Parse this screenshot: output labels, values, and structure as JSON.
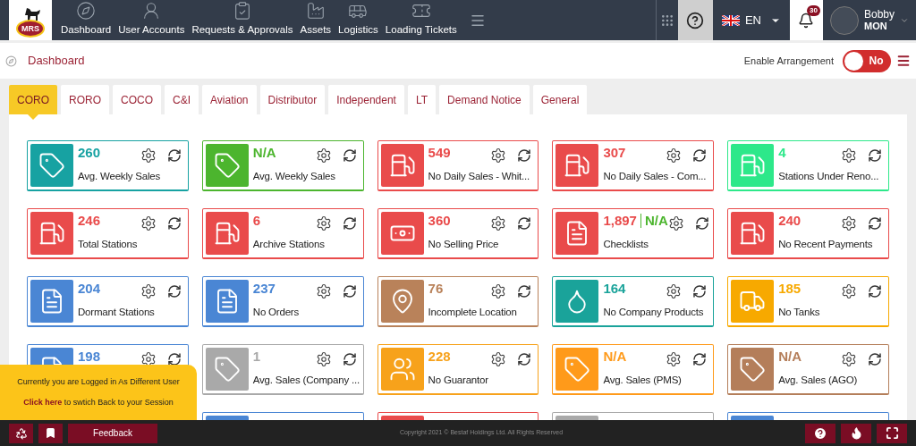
{
  "logo": {
    "text": "MRS"
  },
  "nav": [
    {
      "label": "Dashboard"
    },
    {
      "label": "User Accounts"
    },
    {
      "label": "Requests & Approvals"
    },
    {
      "label": "Assets"
    },
    {
      "label": "Logistics"
    },
    {
      "label": "Loading Tickets"
    }
  ],
  "language": "EN",
  "notifications": {
    "count": "30"
  },
  "user": {
    "name": "Bobby",
    "org": "MON"
  },
  "breadcrumb": "Dashboard",
  "arrangement": {
    "label": "Enable Arrangement",
    "on": false,
    "state_text": "No"
  },
  "tabs": [
    {
      "label": "CORO",
      "selected": true
    },
    {
      "label": "RORO",
      "selected": false
    },
    {
      "label": "COCO",
      "selected": false
    },
    {
      "label": "C&I",
      "selected": false
    },
    {
      "label": "Aviation",
      "selected": false
    },
    {
      "label": "Distributor",
      "selected": false
    },
    {
      "label": "Independent",
      "selected": false
    },
    {
      "label": "LT",
      "selected": false
    },
    {
      "label": "Demand Notice",
      "selected": false
    },
    {
      "label": "General",
      "selected": false
    }
  ],
  "cards": [
    {
      "kind": "tag",
      "color": "#17a2a2",
      "value": "260",
      "label": "Avg. Weekly Sales"
    },
    {
      "kind": "tag",
      "color": "#4cb52e",
      "value": "N/A",
      "label": "Avg. Weekly Sales"
    },
    {
      "kind": "pump",
      "color": "#e94b4b",
      "value": "549",
      "label": "No Daily Sales - Whit..."
    },
    {
      "kind": "pump",
      "color": "#e94b4b",
      "value": "307",
      "label": "No Daily Sales - Com..."
    },
    {
      "kind": "pump",
      "color": "#2de88a",
      "value": "4",
      "label": "Stations Under Reno..."
    },
    {
      "kind": "pump",
      "color": "#e94b4b",
      "value": "246",
      "label": "Total Stations"
    },
    {
      "kind": "pump",
      "color": "#e94b4b",
      "value": "6",
      "label": "Archive Stations"
    },
    {
      "kind": "cash",
      "color": "#e94b4b",
      "value": "360",
      "label": "No Selling Price"
    },
    {
      "kind": "document",
      "color": "#e94b4b",
      "value": "1,897",
      "extra": {
        "text": "N/A",
        "color": "#4cb52e"
      },
      "label": "Checklists"
    },
    {
      "kind": "pump",
      "color": "#e94b4b",
      "value": "240",
      "label": "No Recent Payments"
    },
    {
      "kind": "document",
      "color": "#4a86d4",
      "value": "204",
      "label": "Dormant Stations"
    },
    {
      "kind": "document",
      "color": "#4a86d4",
      "value": "237",
      "label": "No Orders"
    },
    {
      "kind": "pin",
      "color": "#b9825a",
      "value": "76",
      "label": "Incomplete Location"
    },
    {
      "kind": "jerrycan",
      "color": "#1aa39a",
      "value": "164",
      "label": "No Company Products"
    },
    {
      "kind": "tanker",
      "color": "#f7a900",
      "value": "185",
      "label": "No Tanks"
    },
    {
      "kind": "document",
      "color": "#4a86d4",
      "value": "198"
    },
    {
      "kind": "tag",
      "color": "#a9a9a9",
      "value": "1",
      "label": "Avg. Sales (Company ..."
    },
    {
      "kind": "people",
      "color": "#f7a21b",
      "value": "228",
      "label": "No Guarantor"
    },
    {
      "kind": "tag",
      "color": "#ff9a1a",
      "value": "N/A",
      "label": "Avg. Sales (PMS)"
    },
    {
      "kind": "tag",
      "color": "#b47e5a",
      "value": "N/A",
      "label": "Avg. Sales (AGO)"
    },
    {
      "kind": "document",
      "color": "#4a86d4"
    },
    {
      "kind": "pump",
      "color": "#e94b4b"
    },
    {
      "kind": "tag",
      "color": "#a9a9a9"
    },
    {
      "kind": "document",
      "color": "#4a86d4"
    }
  ],
  "session_notice": {
    "message": "Currently you are Logged in As Different User",
    "link": "Click here",
    "rest": "to swtich Back to your Session"
  },
  "footer": {
    "feedback": "Feedback",
    "copyright": "Copyright 2021 © Bestaf Holdings Ltd. All Rights Reserved"
  }
}
